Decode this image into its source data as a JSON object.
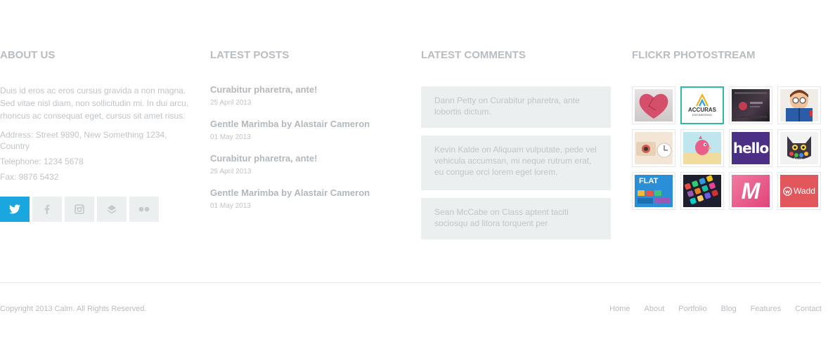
{
  "about": {
    "heading": "ABOUT US",
    "text": "Duis id eros ac eros cursus gravida a non magna. Sed vitae nisl diam, non sollicitudin mi. In dui arcu, rhoncus ac consequat eget, cursus sit amet risus.",
    "address": "Address: Street 9890, New Something 1234, Country",
    "telephone": "Telephone: 1234 5678",
    "fax": "Fax: 9876 5432",
    "social": [
      {
        "name": "twitter-icon",
        "active": true
      },
      {
        "name": "facebook-icon",
        "active": false
      },
      {
        "name": "instagram-icon",
        "active": false
      },
      {
        "name": "layers-icon",
        "active": false
      },
      {
        "name": "flickr-icon",
        "active": false
      }
    ],
    "colors": {
      "twitter_active": "#1aa7e0",
      "button_bg": "#ecefef"
    }
  },
  "posts": {
    "heading": "LATEST POSTS",
    "items": [
      {
        "title": "Curabitur pharetra, ante!",
        "date": "25 April 2013"
      },
      {
        "title": "Gentle Marimba by Alastair Cameron",
        "date": "01 May 2013"
      },
      {
        "title": "Curabitur pharetra, ante!",
        "date": "25 April 2013"
      },
      {
        "title": "Gentle Marimba by Alastair Cameron",
        "date": "01 May 2013"
      }
    ]
  },
  "comments": {
    "heading": "LATEST COMMENTS",
    "items": [
      {
        "text": "Dann Petty on Curabitur pharetra, ante lobortis dictum."
      },
      {
        "text": "Kevin Kalde on Aliquam vulputate, pede vel vehicula accumsan, mi neque rutrum erat, eu congue orci lorem eget lorem."
      },
      {
        "text": "Sean McCabe on Class aptent taciti sociosqu ad litora torquent per"
      }
    ]
  },
  "flickr": {
    "heading": "FLICKR PHOTOSTREAM",
    "accuras_title": "ACCURAS",
    "accuras_sub": "ENGINEERING",
    "hello_text": "hello",
    "docs_text": "docs",
    "flat_text": "FLAT",
    "m_text": "M",
    "wadd_text": "Wadd"
  },
  "footer": {
    "copyright": "Copyright 2013 Calm. All Rights Reserved.",
    "nav": [
      "Home",
      "About",
      "Portfolio",
      "Blog",
      "Features",
      "Contact"
    ]
  }
}
